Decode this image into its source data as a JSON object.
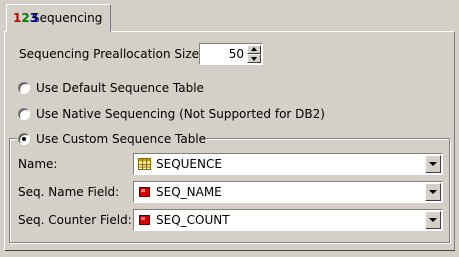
{
  "tab": {
    "label": "Sequencing",
    "icon": "sequence-123-icon"
  },
  "preallocation": {
    "label": "Sequencing Preallocation Size:",
    "value": "50"
  },
  "options": {
    "default_table": "Use Default Sequence Table",
    "native": "Use Native Sequencing (Not Supported for DB2)",
    "custom_table": "Use Custom Sequence Table",
    "selected": "custom_table"
  },
  "custom": {
    "name": {
      "label": "Name:",
      "value": "SEQUENCE",
      "icon": "table-icon"
    },
    "seq_name_field": {
      "label": "Seq. Name Field:",
      "value": "SEQ_NAME",
      "icon": "field-icon"
    },
    "seq_counter_field": {
      "label": "Seq. Counter Field:",
      "value": "SEQ_COUNT",
      "icon": "field-icon"
    }
  },
  "colors": {
    "background": "#d4d0c8",
    "field_icon": "#d40000",
    "table_icon": "#c8a400"
  }
}
